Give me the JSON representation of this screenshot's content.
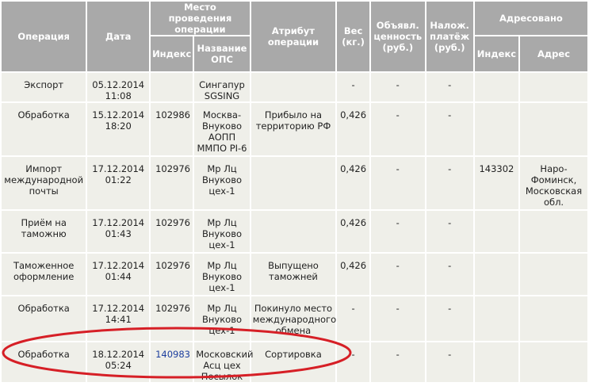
{
  "header": {
    "operation": "Операция",
    "date": "Дата",
    "place": "Место проведения операции",
    "index": "Индекс",
    "ops_name": "Название ОПС",
    "attribute": "Атрибут операции",
    "weight": "Вес (кг.)",
    "declared_value": "Объявл. ценность (руб.)",
    "cod": "Налож. платёж (руб.)",
    "addressed": "Адресовано",
    "addr_index": "Индекс",
    "addr_address": "Адрес"
  },
  "rows": [
    {
      "operation": [
        "Экспорт"
      ],
      "date": [
        "05.12.2014",
        "11:08"
      ],
      "index": "",
      "ops": [
        "Сингапур",
        "SGSING"
      ],
      "attribute": [],
      "weight": "-",
      "value": "-",
      "cod": "-",
      "addr_index": "",
      "addr": []
    },
    {
      "operation": [
        "Обработка"
      ],
      "date": [
        "15.12.2014",
        "18:20"
      ],
      "index": "102986",
      "ops": [
        "Москва-",
        "Внуково",
        "АОПП",
        "ММПО PI-6"
      ],
      "attribute": [
        "Прибыло на",
        "территорию РФ"
      ],
      "weight": "0,426",
      "value": "-",
      "cod": "-",
      "addr_index": "",
      "addr": []
    },
    {
      "operation": [
        "Импорт",
        "международной",
        "почты"
      ],
      "date": [
        "17.12.2014",
        "01:22"
      ],
      "index": "102976",
      "ops": [
        "Мр Лц",
        "Внуково",
        "цех-1"
      ],
      "attribute": [],
      "weight": "0,426",
      "value": "-",
      "cod": "-",
      "addr_index": "143302",
      "addr": [
        "Наро-",
        "Фоминск,",
        "Московская",
        "обл."
      ]
    },
    {
      "operation": [
        "Приём на",
        "таможню"
      ],
      "date": [
        "17.12.2014",
        "01:43"
      ],
      "index": "102976",
      "ops": [
        "Мр Лц",
        "Внуково",
        "цех-1"
      ],
      "attribute": [],
      "weight": "0,426",
      "value": "-",
      "cod": "-",
      "addr_index": "",
      "addr": []
    },
    {
      "operation": [
        "Таможенное",
        "оформление"
      ],
      "date": [
        "17.12.2014",
        "01:44"
      ],
      "index": "102976",
      "ops": [
        "Мр Лц",
        "Внуково",
        "цех-1"
      ],
      "attribute": [
        "Выпущено",
        "таможней"
      ],
      "weight": "0,426",
      "value": "-",
      "cod": "-",
      "addr_index": "",
      "addr": []
    },
    {
      "operation": [
        "Обработка"
      ],
      "date": [
        "17.12.2014",
        "14:41"
      ],
      "index": "102976",
      "ops": [
        "Мр Лц",
        "Внуково",
        "цех-1"
      ],
      "attribute": [
        "Покинуло место",
        "международного",
        "обмена"
      ],
      "weight": "-",
      "value": "-",
      "cod": "-",
      "addr_index": "",
      "addr": []
    },
    {
      "operation": [
        "Обработка"
      ],
      "date": [
        "18.12.2014",
        "05:24"
      ],
      "index": "140983",
      "ops": [
        "Московский",
        "Асц цех",
        "Посылок"
      ],
      "attribute": [
        "Сортировка"
      ],
      "weight": "-",
      "value": "-",
      "cod": "-",
      "addr_index": "",
      "addr": []
    }
  ],
  "colors": {
    "header_bg": "#a9a9a9",
    "cell_bg": "#efefe9",
    "link": "#1d3f9e",
    "highlight_oval": "#d61f26"
  }
}
